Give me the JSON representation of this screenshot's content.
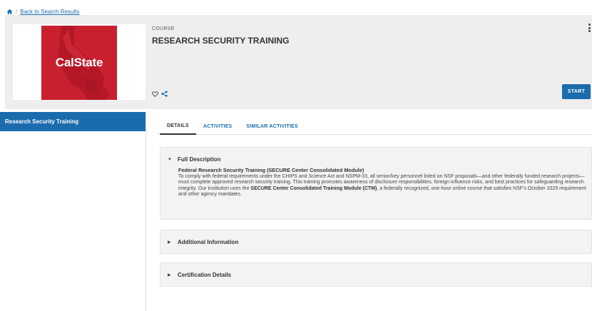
{
  "breadcrumb": {
    "sep": "/",
    "back_link": "Back to Search Results"
  },
  "header": {
    "logo_text": "CalState",
    "course_label": "COURSE",
    "title": "RESEARCH SECURITY TRAINING",
    "start_label": "START"
  },
  "sidebar": {
    "items": [
      {
        "label": "Research Security Training"
      }
    ]
  },
  "tabs": [
    {
      "label": "DETAILS",
      "active": true
    },
    {
      "label": "ACTIVITIES"
    },
    {
      "label": "SIMILAR ACTIVITIES"
    }
  ],
  "sections": {
    "full_description": {
      "heading": "Full Description",
      "subheading": "Federal Research Security Training (SECURE Center Consolidated Module)",
      "text_1": "To comply with federal requirements under the CHIPS and Science Act and NSPM-33, all senior/key personnel listed on NSF proposals—and other federally funded research projects—must complete approved research security training. This training promotes awareness of disclosure responsibilities, foreign influence risks, and best practices for safeguarding research integrity. Our institution uses the ",
      "text_bold": "SECURE Center Consolidated Training Module (CTM)",
      "text_2": ", a federally recognized, one-hour online course that satisfies NSF's October 2025 requirement and other agency mandates."
    },
    "additional_information": {
      "heading": "Additional Information"
    },
    "certification_details": {
      "heading": "Certification Details"
    }
  },
  "colors": {
    "accent": "#1b6cad",
    "logo_red": "#c8202f",
    "panel_bg": "#f3f3f3",
    "header_bg": "#eeeeee"
  },
  "icons": {
    "home": "home-icon",
    "favorite": "heart-icon",
    "share": "share-icon",
    "more": "kebab-menu-icon",
    "expanded": "caret-down-icon",
    "collapsed": "caret-right-icon"
  }
}
